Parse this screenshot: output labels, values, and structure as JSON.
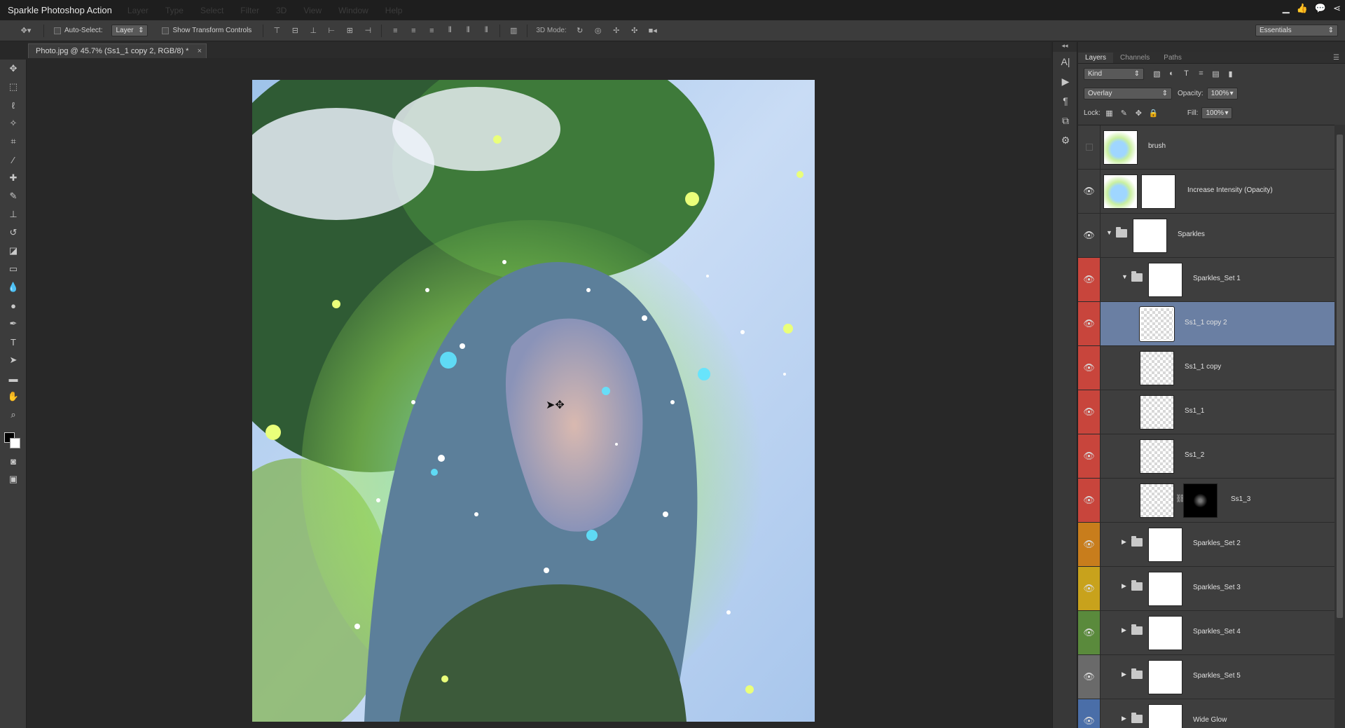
{
  "app": {
    "title": "Sparkle Photoshop Action",
    "menus": [
      "Layer",
      "Type",
      "Select",
      "Filter",
      "3D",
      "View",
      "Window",
      "Help"
    ]
  },
  "options_bar": {
    "auto_select_label": "Auto-Select:",
    "auto_select_value": "Layer",
    "show_transform_label": "Show Transform Controls",
    "mode_3d_label": "3D Mode:",
    "workspace": "Essentials"
  },
  "document": {
    "tab_title": "Photo.jpg @ 45.7% (Ss1_1 copy 2, RGB/8) *",
    "close": "×"
  },
  "layers_panel": {
    "tabs": [
      "Layers",
      "Channels",
      "Paths"
    ],
    "filter_kind": "Kind",
    "blend_mode": "Overlay",
    "opacity_label": "Opacity:",
    "opacity_value": "100%",
    "lock_label": "Lock:",
    "fill_label": "Fill:",
    "fill_value": "100%",
    "layers": [
      {
        "name": "brush",
        "visible": false,
        "color": "none",
        "indent": 0,
        "type": "layer",
        "thumb": "art",
        "selected": false
      },
      {
        "name": "Increase Intensity (Opacity)",
        "visible": true,
        "color": "none",
        "indent": 0,
        "type": "layer-mask",
        "thumb": "art",
        "selected": false
      },
      {
        "name": "Sparkles",
        "visible": true,
        "color": "none",
        "indent": 0,
        "type": "group-open",
        "thumb": "white",
        "selected": false
      },
      {
        "name": "Sparkles_Set 1",
        "visible": true,
        "color": "#c8453c",
        "indent": 1,
        "type": "group-open",
        "thumb": "white",
        "selected": false
      },
      {
        "name": "Ss1_1 copy 2",
        "visible": true,
        "color": "#c8453c",
        "indent": 2,
        "type": "layer",
        "thumb": "checker",
        "selected": true
      },
      {
        "name": "Ss1_1 copy",
        "visible": true,
        "color": "#c8453c",
        "indent": 2,
        "type": "layer",
        "thumb": "checker",
        "selected": false
      },
      {
        "name": "Ss1_1",
        "visible": true,
        "color": "#c8453c",
        "indent": 2,
        "type": "layer",
        "thumb": "checker",
        "selected": false
      },
      {
        "name": "Ss1_2",
        "visible": true,
        "color": "#c8453c",
        "indent": 2,
        "type": "layer",
        "thumb": "checker",
        "selected": false
      },
      {
        "name": "Ss1_3",
        "visible": true,
        "color": "#c8453c",
        "indent": 2,
        "type": "layer-linkmask",
        "thumb": "checker",
        "selected": false
      },
      {
        "name": "Sparkles_Set 2",
        "visible": true,
        "color": "#c87d1c",
        "indent": 1,
        "type": "group-closed",
        "thumb": "white",
        "selected": false
      },
      {
        "name": "Sparkles_Set 3",
        "visible": true,
        "color": "#c8a21c",
        "indent": 1,
        "type": "group-closed",
        "thumb": "white",
        "selected": false
      },
      {
        "name": "Sparkles_Set 4",
        "visible": true,
        "color": "#5a8a3c",
        "indent": 1,
        "type": "group-closed",
        "thumb": "white",
        "selected": false
      },
      {
        "name": "Sparkles_Set 5",
        "visible": true,
        "color": "#6a6a6a",
        "indent": 1,
        "type": "group-closed",
        "thumb": "white",
        "selected": false
      },
      {
        "name": "Wide Glow",
        "visible": true,
        "color": "#4a6ea8",
        "indent": 1,
        "type": "group-closed",
        "thumb": "white",
        "selected": false
      }
    ]
  },
  "icons": {
    "move_tool": "move-tool-icon",
    "eye": "eye-icon",
    "folder": "folder-icon"
  }
}
